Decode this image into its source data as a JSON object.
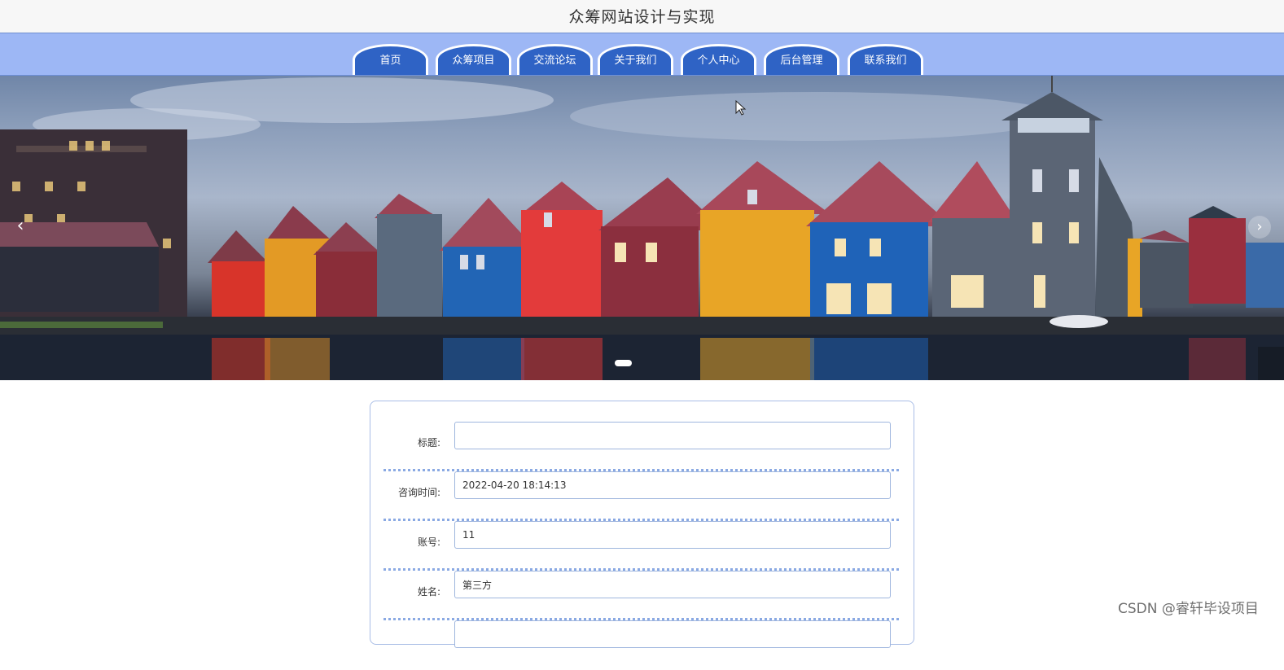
{
  "site": {
    "title": "众筹网站设计与实现"
  },
  "nav": {
    "items": [
      {
        "label": "首页"
      },
      {
        "label": "众筹项目"
      },
      {
        "label": "交流论坛"
      },
      {
        "label": "关于我们"
      },
      {
        "label": "个人中心"
      },
      {
        "label": "后台管理"
      },
      {
        "label": "联系我们"
      }
    ]
  },
  "banner": {
    "prev_icon": "‹",
    "next_icon": "›",
    "side_icon": "‹"
  },
  "form": {
    "fields": [
      {
        "label": "标题:",
        "value": ""
      },
      {
        "label": "咨询时间:",
        "value": "2022-04-20 18:14:13"
      },
      {
        "label": "账号:",
        "value": "11"
      },
      {
        "label": "姓名:",
        "value": "第三方"
      }
    ]
  },
  "watermark": "CSDN @睿轩毕设项目",
  "colors": {
    "nav_bg": "#9db7f5",
    "nav_item": "#2f63c5",
    "field_border": "#9fb6de",
    "divider": "#8aa9e3"
  }
}
